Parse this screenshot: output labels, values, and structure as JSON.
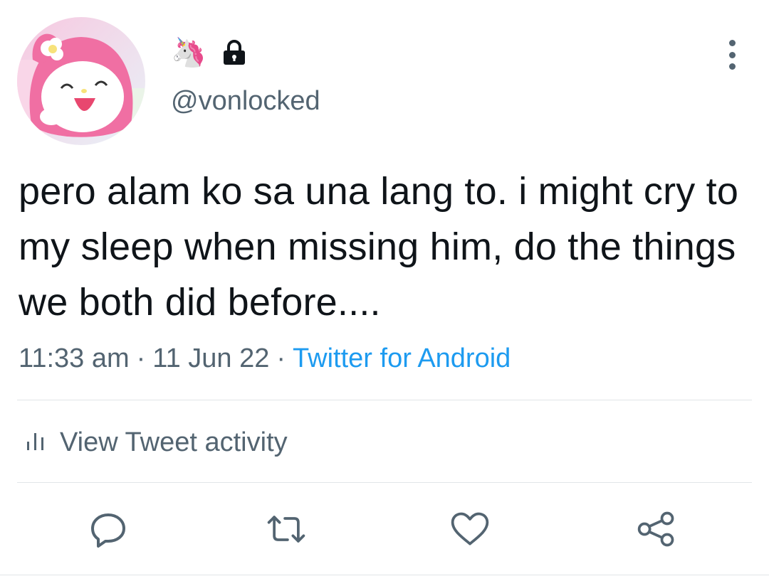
{
  "profile": {
    "display_name_emoji": "🦄",
    "handle": "@vonlocked",
    "protected": true,
    "avatar_description": "pink character avatar"
  },
  "tweet": {
    "text": "pero alam ko sa una lang to. i might cry to my sleep when missing him, do the things we both did before....",
    "time": "11:33 am",
    "date": "11 Jun 22",
    "source": "Twitter for Android",
    "separator": "·"
  },
  "activity": {
    "label": "View Tweet activity"
  },
  "actions": {
    "icons": [
      "reply-icon",
      "retweet-icon",
      "like-icon",
      "share-icon"
    ]
  },
  "colors": {
    "text": "#0f1419",
    "secondary": "#536471",
    "link": "#1d9bf0",
    "divider": "#e1e5e8"
  }
}
